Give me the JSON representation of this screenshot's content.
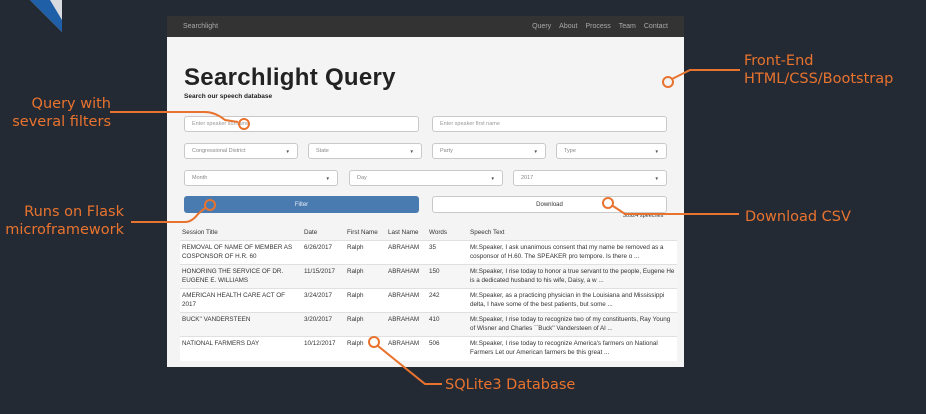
{
  "annotations": {
    "query_filters": "Query with\nseveral filters",
    "flask": "Runs on Flask\nmicroframework",
    "frontend": "Front-End\nHTML/CSS/Bootstrap",
    "download": "Download CSV",
    "sqlite": "SQLite3 Database"
  },
  "colors": {
    "background": "#242a34",
    "accent": "#e8732e",
    "navbar": "#333333",
    "filter_button": "#4a7bb0"
  },
  "navbar": {
    "brand": "Searchlight",
    "links": [
      "Query",
      "About",
      "Process",
      "Team",
      "Contact"
    ]
  },
  "page": {
    "title": "Searchlight Query",
    "subtitle": "Search our speech database"
  },
  "filters": {
    "surname_placeholder": "Enter speaker surname",
    "firstname_placeholder": "Enter speaker first name",
    "district": "Congressional District",
    "state": "State",
    "party": "Party",
    "type": "Type",
    "month": "Month",
    "day": "Day",
    "year": "2017"
  },
  "buttons": {
    "filter": "Filter",
    "download": "Download"
  },
  "speech_count": "30924 speeches",
  "table": {
    "headers": [
      "Session Title",
      "Date",
      "First Name",
      "Last Name",
      "Words",
      "Speech Text"
    ],
    "rows": [
      [
        "REMOVAL OF NAME OF MEMBER AS COSPONSOR OF H.R. 60",
        "6/26/2017",
        "Ralph",
        "ABRAHAM",
        "35",
        "Mr.Speaker, I ask unanimous consent that my name be removed as a cosponsor of H.60. The SPEAKER pro tempore. Is there o ..."
      ],
      [
        "HONORING THE SERVICE OF DR. EUGENE E. WILLIAMS",
        "11/15/2017",
        "Ralph",
        "ABRAHAM",
        "150",
        "Mr.Speaker, I rise today to honor a true servant to the people, Eugene He is a dedicated husband to his wife, Daisy, a w ..."
      ],
      [
        "AMERICAN HEALTH CARE ACT OF 2017",
        "3/24/2017",
        "Ralph",
        "ABRAHAM",
        "242",
        "Mr.Speaker, as a practicing physician in the Louisiana and Mississippi delta, I have some of the best patients, but some ..."
      ],
      [
        "BUCK'' VANDERSTEEN",
        "3/20/2017",
        "Ralph",
        "ABRAHAM",
        "410",
        "Mr.Speaker, I rise today to recognize two of my constituents, Ray Young of Wisner and Charles ``Buck'' Vandersteen of Al ..."
      ],
      [
        "NATIONAL FARMERS DAY",
        "10/12/2017",
        "Ralph",
        "ABRAHAM",
        "506",
        "Mr.Speaker, I rise today to recognize America's farmers on National Farmers Let our American farmers be this great ..."
      ]
    ]
  }
}
